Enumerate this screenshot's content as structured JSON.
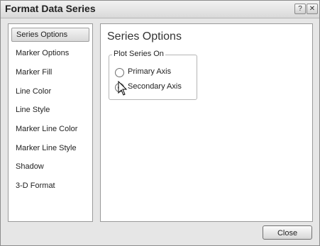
{
  "window": {
    "title": "Format Data Series",
    "help_glyph": "?",
    "close_glyph": "✕"
  },
  "sidebar": {
    "items": [
      {
        "label": "Series Options",
        "selected": true
      },
      {
        "label": "Marker Options",
        "selected": false
      },
      {
        "label": "Marker Fill",
        "selected": false
      },
      {
        "label": "Line Color",
        "selected": false
      },
      {
        "label": "Line Style",
        "selected": false
      },
      {
        "label": "Marker Line Color",
        "selected": false
      },
      {
        "label": "Marker Line Style",
        "selected": false
      },
      {
        "label": "Shadow",
        "selected": false
      },
      {
        "label": "3-D Format",
        "selected": false
      }
    ]
  },
  "main": {
    "title": "Series Options",
    "plot_group": {
      "legend": "Plot Series On",
      "options": [
        {
          "label": "Primary Axis",
          "selected": false
        },
        {
          "label": "Secondary Axis",
          "selected": true
        }
      ]
    }
  },
  "footer": {
    "close_label": "Close"
  }
}
